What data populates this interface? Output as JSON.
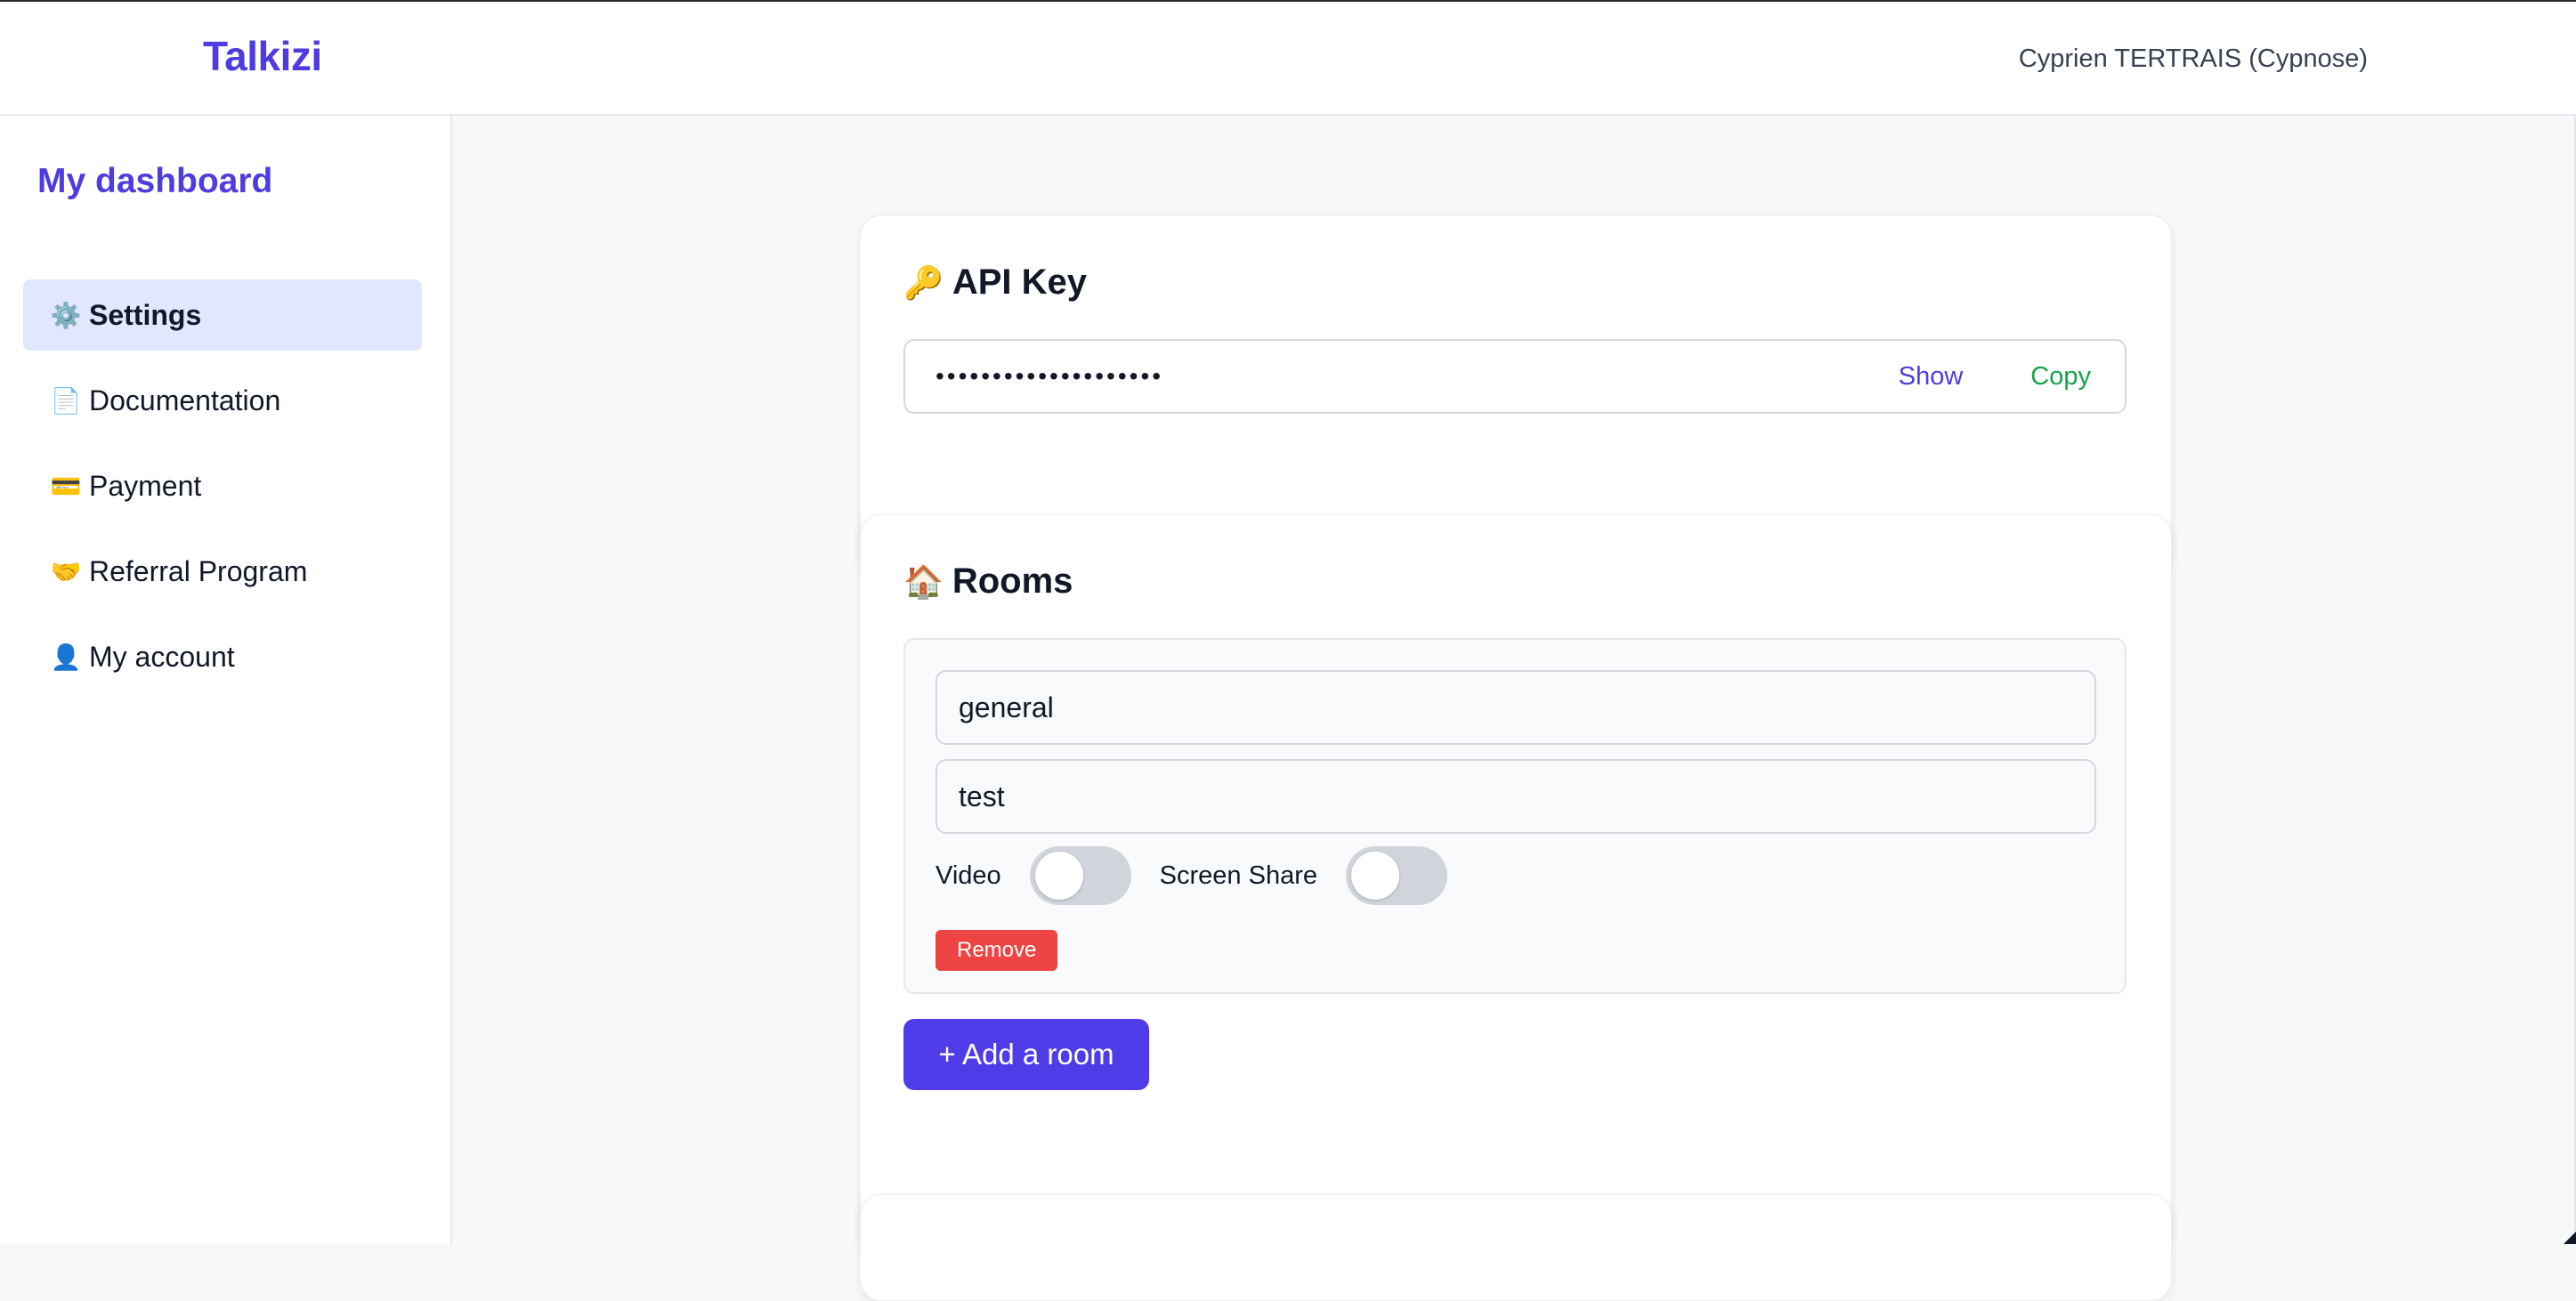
{
  "header": {
    "brand": "Talkizi",
    "user": "Cyprien TERTRAIS (Cypnose)"
  },
  "sidebar": {
    "title": "My dashboard",
    "items": [
      {
        "icon": "⚙️",
        "label": "Settings",
        "active": true
      },
      {
        "icon": "📄",
        "label": "Documentation"
      },
      {
        "icon": "💳",
        "label": "Payment"
      },
      {
        "icon": "🤝",
        "label": "Referral Program"
      },
      {
        "icon": "👤",
        "label": "My account"
      }
    ]
  },
  "api_key": {
    "icon": "🔑",
    "title": "API Key",
    "masked_value": "••••••••••••••••••••",
    "show_label": "Show",
    "copy_label": "Copy"
  },
  "rooms": {
    "icon": "🏠",
    "title": "Rooms",
    "items": [
      {
        "name": "general",
        "description": "test",
        "video_label": "Video",
        "video_enabled": false,
        "screen_share_label": "Screen Share",
        "screen_share_enabled": false,
        "remove_label": "Remove"
      }
    ],
    "add_label": "+ Add a room"
  },
  "colors": {
    "brand": "#4f3ce0",
    "active_nav_bg": "#e0e7ff",
    "copy_green": "#16a34a",
    "remove_red": "#ef4444",
    "add_button": "#4f3ce8"
  }
}
